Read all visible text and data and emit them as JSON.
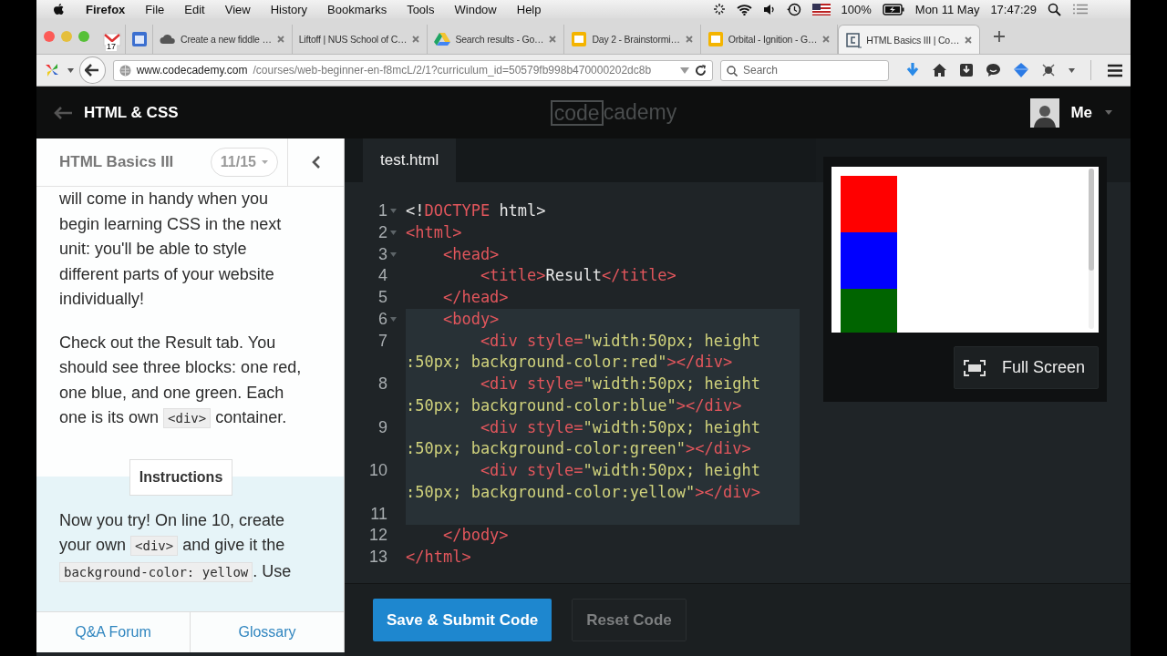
{
  "menubar": {
    "app": "Firefox",
    "menus": [
      "File",
      "Edit",
      "View",
      "History",
      "Bookmarks",
      "Tools",
      "Window",
      "Help"
    ],
    "battery": "100%",
    "date": "Mon 11 May",
    "time": "17:47:29"
  },
  "tabs": [
    {
      "kind": "mail",
      "badge": "17",
      "selected": false
    },
    {
      "kind": "calendar",
      "selected": false
    },
    {
      "kind": "cloud",
      "title": "Create a new fiddle …",
      "selected": false
    },
    {
      "kind": "plain",
      "title": "Liftoff | NUS School of C…",
      "selected": false
    },
    {
      "kind": "drive",
      "title": "Search results - Go…",
      "selected": false
    },
    {
      "kind": "slides",
      "title": "Day 2 - Brainstormi…",
      "selected": false
    },
    {
      "kind": "slides",
      "title": "Orbital - Ignition - G…",
      "selected": false
    },
    {
      "kind": "page",
      "title": "HTML Basics III | Co…",
      "selected": true
    }
  ],
  "toolbar": {
    "url_host": "www.codecademy.com",
    "url_path": "/courses/web-beginner-en-f8mcL/2/1?curriculum_id=50579fb998b470000202dc8b",
    "search_placeholder": "Search"
  },
  "header": {
    "course": "HTML & CSS",
    "logo": {
      "boxed": "code",
      "rest": "cademy"
    },
    "user": "Me"
  },
  "lesson": {
    "title": "HTML Basics III",
    "progress": "11/15",
    "paragraphs": [
      [
        {
          "kind": "text",
          "text": "will come in handy when you begin learning CSS in the next unit: you'll be able to style different parts of your website individually!"
        }
      ],
      [
        {
          "kind": "text",
          "text": "Check out the Result tab. You should see three blocks: one red, one blue, and one green. Each one is its own "
        },
        {
          "kind": "code",
          "text": "<div>"
        },
        {
          "kind": "text",
          "text": " container."
        }
      ]
    ],
    "instructions_label": "Instructions",
    "instructions": [
      {
        "kind": "text",
        "text": "Now you try! On line 10, create your own "
      },
      {
        "kind": "code",
        "text": "<div>"
      },
      {
        "kind": "text",
        "text": " and give it the "
      },
      {
        "kind": "code",
        "text": "background-color: yellow"
      },
      {
        "kind": "text",
        "text": ". Use"
      }
    ],
    "links": [
      "Q&A Forum",
      "Glossary"
    ]
  },
  "editor": {
    "file": "test.html",
    "lines": [
      {
        "number": "1",
        "fold": true,
        "selected": false,
        "rows": [
          [
            {
              "kind": "text",
              "text": "<!"
            },
            {
              "kind": "tag",
              "text": "DOCTYPE"
            },
            {
              "kind": "text",
              "text": " html>"
            }
          ]
        ]
      },
      {
        "number": "2",
        "fold": true,
        "selected": false,
        "rows": [
          [
            {
              "kind": "tag",
              "text": "<html>"
            }
          ]
        ]
      },
      {
        "number": "3",
        "fold": true,
        "selected": false,
        "rows": [
          [
            {
              "kind": "tag",
              "text": "    <head>"
            }
          ]
        ]
      },
      {
        "number": "4",
        "fold": false,
        "selected": false,
        "rows": [
          [
            {
              "kind": "tag",
              "text": "        <title>"
            },
            {
              "kind": "text",
              "text": "Result"
            },
            {
              "kind": "tag",
              "text": "</title>"
            }
          ]
        ]
      },
      {
        "number": "5",
        "fold": false,
        "selected": false,
        "rows": [
          [
            {
              "kind": "tag",
              "text": "    </head>"
            }
          ]
        ]
      },
      {
        "number": "6",
        "fold": true,
        "selected": true,
        "rows": [
          [
            {
              "kind": "tag",
              "text": "    <body>"
            }
          ]
        ]
      },
      {
        "number": "7",
        "fold": false,
        "selected": true,
        "rows": [
          [
            {
              "kind": "tag",
              "text": "        <div style="
            },
            {
              "kind": "string",
              "text": "\"width:50px; height"
            }
          ],
          [
            {
              "kind": "string",
              "text": ":50px; background-color:red\""
            },
            {
              "kind": "tag",
              "text": "></div>"
            }
          ]
        ]
      },
      {
        "number": "8",
        "fold": false,
        "selected": true,
        "rows": [
          [
            {
              "kind": "tag",
              "text": "        <div style="
            },
            {
              "kind": "string",
              "text": "\"width:50px; height"
            }
          ],
          [
            {
              "kind": "string",
              "text": ":50px; background-color:blue\""
            },
            {
              "kind": "tag",
              "text": "></div>"
            }
          ]
        ]
      },
      {
        "number": "9",
        "fold": false,
        "selected": true,
        "rows": [
          [
            {
              "kind": "tag",
              "text": "        <div style="
            },
            {
              "kind": "string",
              "text": "\"width:50px; height"
            }
          ],
          [
            {
              "kind": "string",
              "text": ":50px; background-color:green\""
            },
            {
              "kind": "tag",
              "text": "></div>"
            }
          ]
        ]
      },
      {
        "number": "10",
        "fold": false,
        "selected": true,
        "rows": [
          [
            {
              "kind": "tag",
              "text": "        <div style="
            },
            {
              "kind": "string",
              "text": "\"width:50px; height"
            }
          ],
          [
            {
              "kind": "string",
              "text": ":50px; background-color:yellow\""
            },
            {
              "kind": "tag",
              "text": "></div>"
            }
          ]
        ]
      },
      {
        "number": "11",
        "fold": false,
        "selected": true,
        "rows": [
          []
        ]
      },
      {
        "number": "12",
        "fold": false,
        "selected": false,
        "rows": [
          [
            {
              "kind": "tag",
              "text": "    </body>"
            }
          ]
        ]
      },
      {
        "number": "13",
        "fold": false,
        "selected": false,
        "rows": [
          [
            {
              "kind": "tag",
              "text": "</html>"
            }
          ]
        ]
      }
    ]
  },
  "result": {
    "blocks": [
      {
        "color": "#ff0000"
      },
      {
        "color": "#0000ff"
      },
      {
        "color": "#006400"
      }
    ],
    "fullscreen": "Full Screen"
  },
  "actions": [
    {
      "label": "Save & Submit Code",
      "kind": "primary"
    },
    {
      "label": "Reset Code",
      "kind": "secondary"
    }
  ]
}
